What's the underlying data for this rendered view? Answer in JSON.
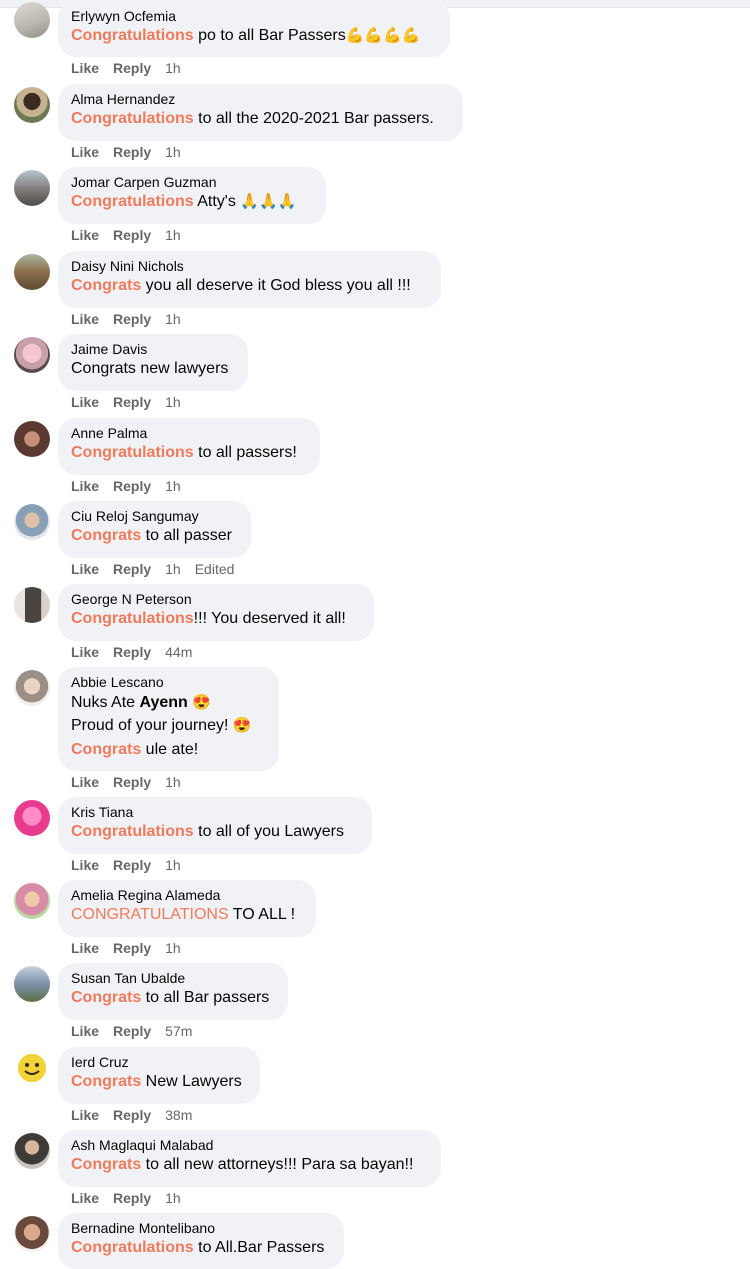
{
  "action_like": "Like",
  "action_reply": "Reply",
  "comments": [
    {
      "author": "Erlywyn Ocfemia",
      "hl": "Congratulations",
      "rest": " po to all Bar Passers",
      "emoji": "💪💪💪💪",
      "time": "1h",
      "avatar_color": "#b9b6ad"
    },
    {
      "author": "Alma Hernandez",
      "hl": "Congratulations",
      "rest": " to all the 2020-2021 Bar passers.",
      "time": "1h",
      "avatar_color": "#6b7a52"
    },
    {
      "author": "Jomar Carpen Guzman",
      "hl": "Congratulations",
      "rest": " Atty's ",
      "emoji": "🙏🙏🙏",
      "time": "1h",
      "avatar_color": "#7d7a78"
    },
    {
      "author": "Daisy Nini Nichols",
      "hl": "Congrats",
      "rest": " you all deserve it God bless you all !!!",
      "time": "1h",
      "avatar_color": "#8c6f4d"
    },
    {
      "author": "Jaime Davis",
      "text": "Congrats new lawyers",
      "time": "1h",
      "avatar_color": "#c9a0a9"
    },
    {
      "author": "Anne Palma",
      "hl": "Congratulations",
      "rest": " to all passers!",
      "time": "1h",
      "avatar_color": "#5a3a30"
    },
    {
      "author": "Ciu Reloj Sangumay",
      "hl": "Congrats",
      "rest": " to all passer",
      "time": "1h",
      "edited": "Edited",
      "avatar_color": "#8aa0b8"
    },
    {
      "author": "George N Peterson",
      "hl": "Congratulations",
      "rest": "!!! You deserved it all!",
      "time": "44m",
      "avatar_color": "#4a4440"
    },
    {
      "author": "Abbie Lescano",
      "line1_text": "Nuks Ate ",
      "line1_bold": "Ayenn",
      "line1_emoji": "😍",
      "line2_text": "Proud of your journey! ",
      "line2_emoji": "😍",
      "line3_hl": "Congrats",
      "line3_rest": " ule ate!",
      "time": "1h",
      "avatar_color": "#9b8f86"
    },
    {
      "author": "Kris Tiana",
      "hl": "Congratulations",
      "rest": " to all of you Lawyers",
      "time": "1h",
      "avatar_color": "#e83a8f"
    },
    {
      "author": "Amelia Regina Alameda",
      "hl": "CONGRATULATIONS",
      "rest": " TO ALL !",
      "time": "1h",
      "avatar_color": "#d98aa8"
    },
    {
      "author": "Susan Tan Ubalde",
      "hl": "Congrats",
      "rest": " to all Bar passers",
      "time": "57m",
      "avatar_color": "#7b8fa6"
    },
    {
      "author": "Ierd Cruz",
      "hl": "Congrats",
      "rest": " New Lawyers",
      "time": "38m",
      "avatar_color": "#f2d43a"
    },
    {
      "author": "Ash Maglaqui Malabad",
      "hl": "Congrats",
      "rest": " to all new attorneys!!! Para sa bayan!!",
      "time": "1h",
      "avatar_color": "#3d3a38"
    },
    {
      "author": "Bernadine Montelibano",
      "hl": "Congratulations",
      "rest": " to All.Bar Passers",
      "time": "",
      "avatar_color": "#6a4a3c"
    }
  ]
}
